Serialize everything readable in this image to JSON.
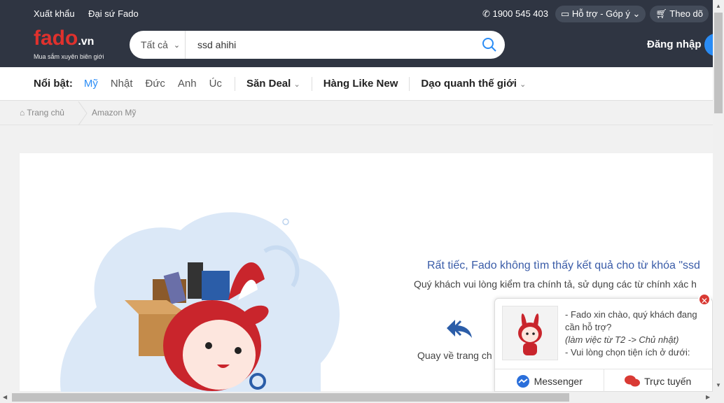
{
  "topbar": {
    "export_link": "Xuất khẩu",
    "ambassador_link": "Đại sứ Fado",
    "phone": "1900 545 403",
    "support": "Hỗ trợ - Góp ý",
    "follow": "Theo dõ"
  },
  "logo": {
    "brand": "fado",
    "suffix": ".vn",
    "tagline": "Mua sắm xuyên biên giới"
  },
  "search": {
    "category": "Tất cả",
    "query": "ssd ahihi"
  },
  "login": "Đăng nhập",
  "nav": {
    "label": "Nổi bật:",
    "countries": [
      "Mỹ",
      "Nhật",
      "Đức",
      "Anh",
      "Úc"
    ],
    "deal": "Săn Deal",
    "like_new": "Hàng Like New",
    "world": "Dạo quanh thế giới"
  },
  "breadcrumb": {
    "home": "Trang chủ",
    "current": "Amazon Mỹ"
  },
  "empty": {
    "title": "Rất tiếc, Fado không tìm thấy kết quả cho từ khóa \"ssd",
    "hint": "Quý khách vui lòng kiểm tra chính tả, sử dụng các từ chính xác h",
    "back": "Quay về trang ch"
  },
  "chat": {
    "line1": "- Fado xin chào, quý khách đang cần hỗ trợ?",
    "line2": "(làm việc từ T2 -> Chủ nhật)",
    "line3": "- Vui lòng chọn tiện ích ở dưới:",
    "messenger": "Messenger",
    "online": "Trực tuyến"
  },
  "colors": {
    "topbar": "#2f3542",
    "accent": "#2a8cf5",
    "brand": "#e0312d"
  }
}
